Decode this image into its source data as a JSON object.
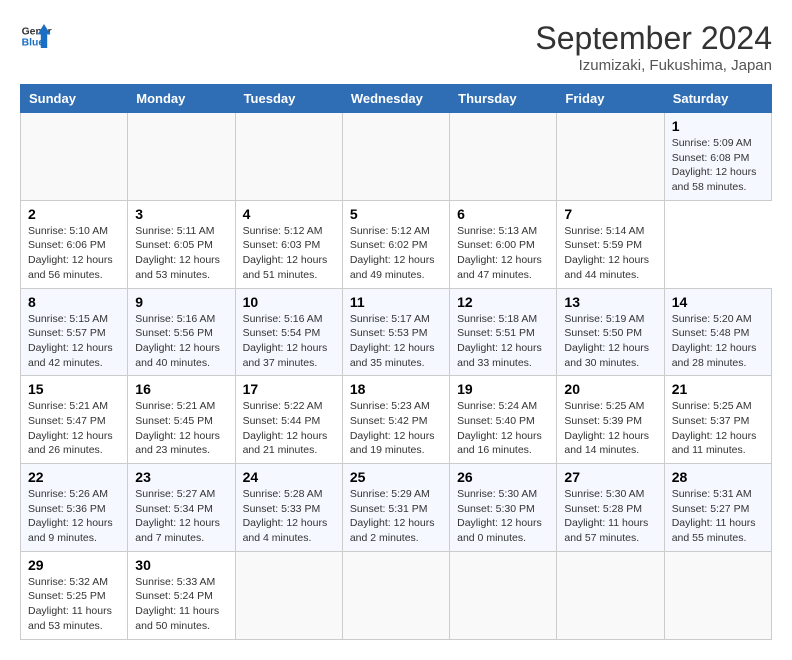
{
  "header": {
    "logo_line1": "General",
    "logo_line2": "Blue",
    "title": "September 2024",
    "subtitle": "Izumizaki, Fukushima, Japan"
  },
  "calendar": {
    "days_of_week": [
      "Sunday",
      "Monday",
      "Tuesday",
      "Wednesday",
      "Thursday",
      "Friday",
      "Saturday"
    ],
    "weeks": [
      [
        {
          "day": "",
          "info": ""
        },
        {
          "day": "",
          "info": ""
        },
        {
          "day": "",
          "info": ""
        },
        {
          "day": "",
          "info": ""
        },
        {
          "day": "",
          "info": ""
        },
        {
          "day": "",
          "info": ""
        },
        {
          "day": "1",
          "info": "Sunrise: 5:09 AM\nSunset: 6:08 PM\nDaylight: 12 hours\nand 58 minutes."
        }
      ],
      [
        {
          "day": "2",
          "info": "Sunrise: 5:10 AM\nSunset: 6:06 PM\nDaylight: 12 hours\nand 56 minutes."
        },
        {
          "day": "3",
          "info": "Sunrise: 5:11 AM\nSunset: 6:05 PM\nDaylight: 12 hours\nand 53 minutes."
        },
        {
          "day": "4",
          "info": "Sunrise: 5:12 AM\nSunset: 6:03 PM\nDaylight: 12 hours\nand 51 minutes."
        },
        {
          "day": "5",
          "info": "Sunrise: 5:12 AM\nSunset: 6:02 PM\nDaylight: 12 hours\nand 49 minutes."
        },
        {
          "day": "6",
          "info": "Sunrise: 5:13 AM\nSunset: 6:00 PM\nDaylight: 12 hours\nand 47 minutes."
        },
        {
          "day": "7",
          "info": "Sunrise: 5:14 AM\nSunset: 5:59 PM\nDaylight: 12 hours\nand 44 minutes."
        }
      ],
      [
        {
          "day": "8",
          "info": "Sunrise: 5:15 AM\nSunset: 5:57 PM\nDaylight: 12 hours\nand 42 minutes."
        },
        {
          "day": "9",
          "info": "Sunrise: 5:16 AM\nSunset: 5:56 PM\nDaylight: 12 hours\nand 40 minutes."
        },
        {
          "day": "10",
          "info": "Sunrise: 5:16 AM\nSunset: 5:54 PM\nDaylight: 12 hours\nand 37 minutes."
        },
        {
          "day": "11",
          "info": "Sunrise: 5:17 AM\nSunset: 5:53 PM\nDaylight: 12 hours\nand 35 minutes."
        },
        {
          "day": "12",
          "info": "Sunrise: 5:18 AM\nSunset: 5:51 PM\nDaylight: 12 hours\nand 33 minutes."
        },
        {
          "day": "13",
          "info": "Sunrise: 5:19 AM\nSunset: 5:50 PM\nDaylight: 12 hours\nand 30 minutes."
        },
        {
          "day": "14",
          "info": "Sunrise: 5:20 AM\nSunset: 5:48 PM\nDaylight: 12 hours\nand 28 minutes."
        }
      ],
      [
        {
          "day": "15",
          "info": "Sunrise: 5:21 AM\nSunset: 5:47 PM\nDaylight: 12 hours\nand 26 minutes."
        },
        {
          "day": "16",
          "info": "Sunrise: 5:21 AM\nSunset: 5:45 PM\nDaylight: 12 hours\nand 23 minutes."
        },
        {
          "day": "17",
          "info": "Sunrise: 5:22 AM\nSunset: 5:44 PM\nDaylight: 12 hours\nand 21 minutes."
        },
        {
          "day": "18",
          "info": "Sunrise: 5:23 AM\nSunset: 5:42 PM\nDaylight: 12 hours\nand 19 minutes."
        },
        {
          "day": "19",
          "info": "Sunrise: 5:24 AM\nSunset: 5:40 PM\nDaylight: 12 hours\nand 16 minutes."
        },
        {
          "day": "20",
          "info": "Sunrise: 5:25 AM\nSunset: 5:39 PM\nDaylight: 12 hours\nand 14 minutes."
        },
        {
          "day": "21",
          "info": "Sunrise: 5:25 AM\nSunset: 5:37 PM\nDaylight: 12 hours\nand 11 minutes."
        }
      ],
      [
        {
          "day": "22",
          "info": "Sunrise: 5:26 AM\nSunset: 5:36 PM\nDaylight: 12 hours\nand 9 minutes."
        },
        {
          "day": "23",
          "info": "Sunrise: 5:27 AM\nSunset: 5:34 PM\nDaylight: 12 hours\nand 7 minutes."
        },
        {
          "day": "24",
          "info": "Sunrise: 5:28 AM\nSunset: 5:33 PM\nDaylight: 12 hours\nand 4 minutes."
        },
        {
          "day": "25",
          "info": "Sunrise: 5:29 AM\nSunset: 5:31 PM\nDaylight: 12 hours\nand 2 minutes."
        },
        {
          "day": "26",
          "info": "Sunrise: 5:30 AM\nSunset: 5:30 PM\nDaylight: 12 hours\nand 0 minutes."
        },
        {
          "day": "27",
          "info": "Sunrise: 5:30 AM\nSunset: 5:28 PM\nDaylight: 11 hours\nand 57 minutes."
        },
        {
          "day": "28",
          "info": "Sunrise: 5:31 AM\nSunset: 5:27 PM\nDaylight: 11 hours\nand 55 minutes."
        }
      ],
      [
        {
          "day": "29",
          "info": "Sunrise: 5:32 AM\nSunset: 5:25 PM\nDaylight: 11 hours\nand 53 minutes."
        },
        {
          "day": "30",
          "info": "Sunrise: 5:33 AM\nSunset: 5:24 PM\nDaylight: 11 hours\nand 50 minutes."
        },
        {
          "day": "",
          "info": ""
        },
        {
          "day": "",
          "info": ""
        },
        {
          "day": "",
          "info": ""
        },
        {
          "day": "",
          "info": ""
        },
        {
          "day": "",
          "info": ""
        }
      ]
    ]
  }
}
